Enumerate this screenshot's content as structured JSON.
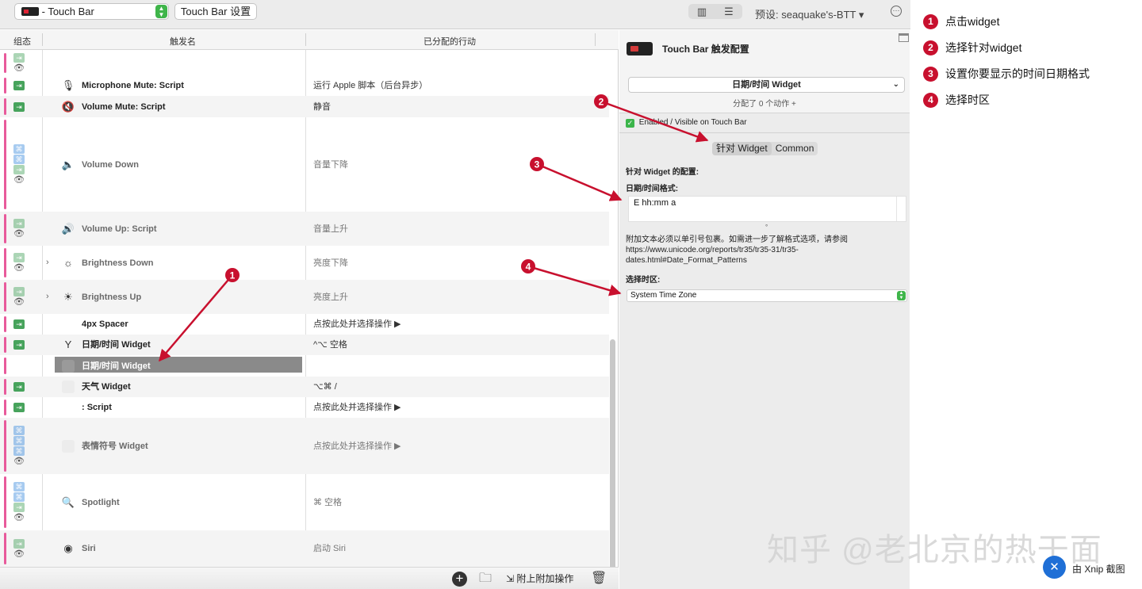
{
  "toolbar": {
    "mode_selected": "- Touch Bar",
    "settings_label": "Touch Bar 设置",
    "view_columns_glyph": "▥",
    "view_list_glyph": "☰",
    "preset_label": "预设: seaquake's-BTT ▾",
    "more_glyph": "···"
  },
  "table": {
    "columns": [
      "组态",
      "触发名",
      "已分配的行动"
    ],
    "rows": [
      {
        "name": "",
        "action": "",
        "badges": [
          "g",
          "eye"
        ],
        "alt": false,
        "dim": true,
        "icon": "",
        "icon_name": "none",
        "disclose": ""
      },
      {
        "name": "Microphone Mute: Script",
        "action": "运行 Apple 脚本（后台异步）",
        "badges": [
          "g"
        ],
        "alt": false,
        "dim": false,
        "icon": "🎙",
        "icon_name": "microphone-icon",
        "disclose": ""
      },
      {
        "name": "Volume Mute: Script",
        "action": "静音",
        "badges": [
          "g"
        ],
        "alt": true,
        "dim": false,
        "icon": "🔇",
        "icon_name": "volume-mute-icon",
        "disclose": ""
      },
      {
        "name": "Volume Down",
        "action": "音量下降",
        "badges": [
          "b",
          "b",
          "g",
          "eye"
        ],
        "alt": false,
        "dim": true,
        "icon": "🔈",
        "icon_name": "volume-down-icon",
        "disclose": ""
      },
      {
        "name": "Volume Up: Script",
        "action": "音量上升",
        "badges": [
          "g",
          "eye"
        ],
        "alt": true,
        "dim": true,
        "icon": "🔊",
        "icon_name": "volume-up-icon",
        "disclose": ""
      },
      {
        "name": "Brightness Down",
        "action": "亮度下降",
        "badges": [
          "g",
          "eye"
        ],
        "alt": false,
        "dim": true,
        "icon": "☼",
        "icon_name": "brightness-down-icon",
        "disclose": "›"
      },
      {
        "name": "Brightness Up",
        "action": "亮度上升",
        "badges": [
          "g",
          "eye"
        ],
        "alt": true,
        "dim": true,
        "icon": "☀",
        "icon_name": "brightness-up-icon",
        "disclose": "›"
      },
      {
        "name": "4px Spacer",
        "action": "点按此处并选择操作 ▶",
        "badges": [
          "g"
        ],
        "alt": false,
        "dim": false,
        "icon": "",
        "icon_name": "none",
        "disclose": ""
      },
      {
        "name": "日期/时间 Widget",
        "action": "^⌥ 空格",
        "badges": [
          "g"
        ],
        "alt": true,
        "dim": false,
        "icon": "Y",
        "icon_name": "date-time-icon",
        "disclose": ""
      },
      {
        "name": "日期/时间 Widget",
        "action": "",
        "badges": [],
        "alt": false,
        "dim": false,
        "icon": "",
        "icon_name": "widget-placeholder-icon",
        "disclose": "",
        "selected": true
      },
      {
        "name": "天气 Widget",
        "action": "⌥⌘ /",
        "badges": [
          "g"
        ],
        "alt": true,
        "dim": false,
        "icon": "",
        "icon_name": "widget-placeholder-icon",
        "disclose": ""
      },
      {
        "name": ": Script",
        "action": "点按此处并选择操作 ▶",
        "badges": [
          "g"
        ],
        "alt": false,
        "dim": false,
        "icon": "",
        "icon_name": "none",
        "disclose": ""
      },
      {
        "name": "表情符号 Widget",
        "action": "点按此处并选择操作 ▶",
        "badges": [
          "b",
          "b",
          "b",
          "eye"
        ],
        "alt": true,
        "dim": true,
        "icon": "",
        "icon_name": "widget-placeholder-icon",
        "disclose": ""
      },
      {
        "name": "Spotlight",
        "action": "⌘ 空格",
        "badges": [
          "b",
          "b",
          "g",
          "eye"
        ],
        "alt": false,
        "dim": true,
        "icon": "🔍",
        "icon_name": "search-icon",
        "disclose": ""
      },
      {
        "name": "Siri",
        "action": "启动 Siri",
        "badges": [
          "g",
          "eye"
        ],
        "alt": true,
        "dim": true,
        "icon": "◉",
        "icon_name": "siri-icon",
        "disclose": ""
      }
    ],
    "badge_glyphs": {
      "g": "⇥",
      "b": "⌘",
      "eye": "👁"
    },
    "bottom": {
      "add_glyph": "+",
      "folder_glyph": "🗀",
      "attach_label": "⇲ 附上附加操作",
      "trash_glyph": "🗑"
    }
  },
  "panel": {
    "title": "Touch Bar 触发配置",
    "type_selected": "日期/时间 Widget",
    "type_chevron": "⌄",
    "assigned": "分配了 0 个动作 +",
    "enabled_check": "✓",
    "enabled_label": "Enabled / Visible on Touch Bar",
    "tabs": [
      "针对 Widget",
      "Common"
    ],
    "widget_config_title": "针对 Widget 的配置:",
    "format_label": "日期/时间格式:",
    "format_value": "E hh:mm a",
    "format_dot": "°",
    "format_help": "附加文本必须以单引号包裹。如需进一步了解格式选项，请参阅 https://www.unicode.org/reports/tr35/tr35-31/tr35-dates.html#Date_Format_Patterns",
    "timezone_label": "选择时区:",
    "timezone_value": "System Time Zone",
    "stepper_glyph": "⇕"
  },
  "annotations": {
    "color": "#c8102e",
    "markers": [
      "1",
      "2",
      "3",
      "4"
    ]
  },
  "legend": [
    {
      "num": "1",
      "text": "点击widget"
    },
    {
      "num": "2",
      "text": "选择针对widget"
    },
    {
      "num": "3",
      "text": "设置你要显示的时间日期格式"
    },
    {
      "num": "4",
      "text": "选择时区"
    }
  ],
  "watermark": "知乎 @老北京的热干面",
  "xnip": {
    "logo_glyph": "✕",
    "label": "由 Xnip 截图"
  }
}
